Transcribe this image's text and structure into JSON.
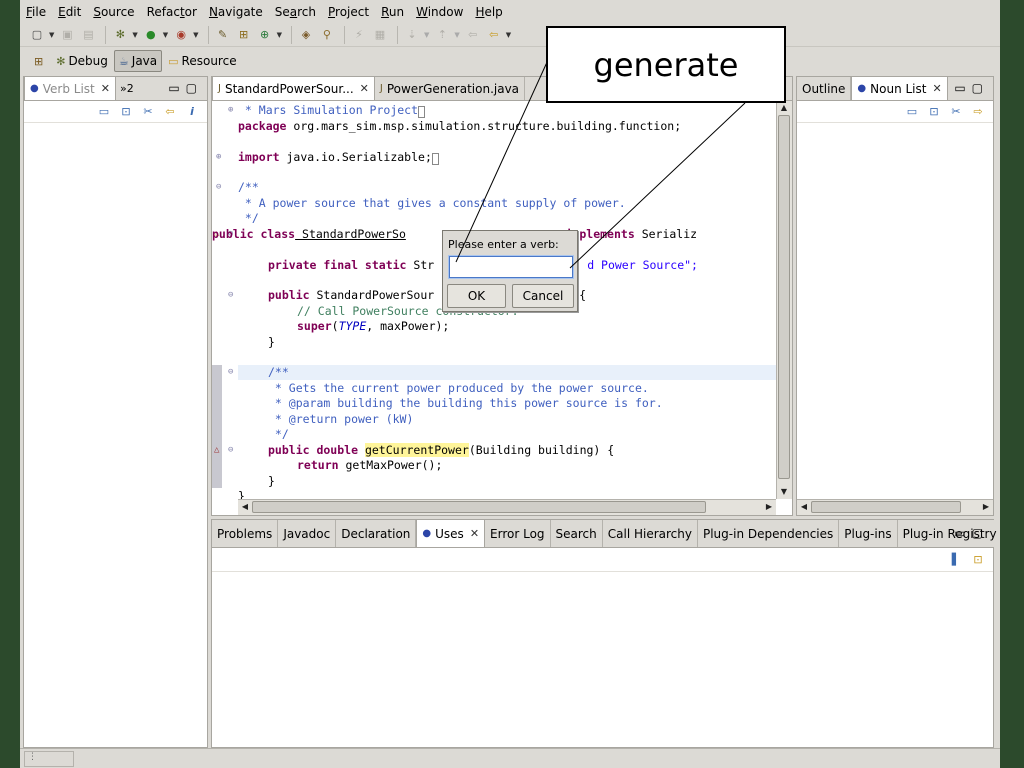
{
  "menu": [
    "File",
    "Edit",
    "Source",
    "Refactor",
    "Navigate",
    "Search",
    "Project",
    "Run",
    "Window",
    "Help"
  ],
  "perspectives": {
    "debug": "Debug",
    "java": "Java",
    "resource": "Resource"
  },
  "left_panel": {
    "tab": "Verb List",
    "overflow": "»2"
  },
  "editor": {
    "tabs": [
      {
        "label": "StandardPowerSour..."
      },
      {
        "label": "PowerGeneration.java"
      }
    ]
  },
  "right_panel": {
    "tabs": [
      "Outline",
      "Noun List"
    ]
  },
  "bottom_panel": {
    "tabs": [
      "Problems",
      "Javadoc",
      "Declaration",
      "Uses",
      "Error Log",
      "Search",
      "Call Hierarchy",
      "Plug-in Dependencies",
      "Plug-ins",
      "Plug-in Registry"
    ],
    "overflow": "»2"
  },
  "code": {
    "l1": " * Mars Simulation Project",
    "l2_kw": "package",
    "l2": " org.mars_sim.msp.simulation.structure.building.function;",
    "l3_kw": "import",
    "l3": " java.io.Serializable;",
    "l4": "/**",
    "l5": " * A power source that gives a constant supply of power.",
    "l6": " */",
    "l7_kw1": "public class",
    "l7_a": " StandardPowerSo",
    "l7_b": "urce",
    "l7_kw2": "implements",
    "l7_c": " Serializ",
    "l8_kw": "private final static",
    "l8_a": " Str",
    "l8_b": "d Power Source\";",
    "l9_kw": "public",
    "l9_a": " StandardPowerSour",
    "l9_b": "{",
    "l10": "// Call PowerSource constructor.",
    "l11_kw": "super",
    "l11_i": "TYPE",
    "l11": ", maxPower);",
    "l12": "}",
    "l13": "/**",
    "l14": " * Gets the current power produced by the power source.",
    "l15": " * @param building the building this power source is for.",
    "l16": " * @return power (kW)",
    "l17": " */",
    "l18_kw": "public double",
    "l18_fn": "getCurrentPower",
    "l18": "(Building building) {",
    "l19_kw": "return",
    "l19": " getMaxPower();",
    "l20": "}",
    "l21": "}"
  },
  "dialog": {
    "prompt": "Please enter a verb:",
    "value": "",
    "ok": "OK",
    "cancel": "Cancel"
  },
  "callout": {
    "text": "generate"
  }
}
